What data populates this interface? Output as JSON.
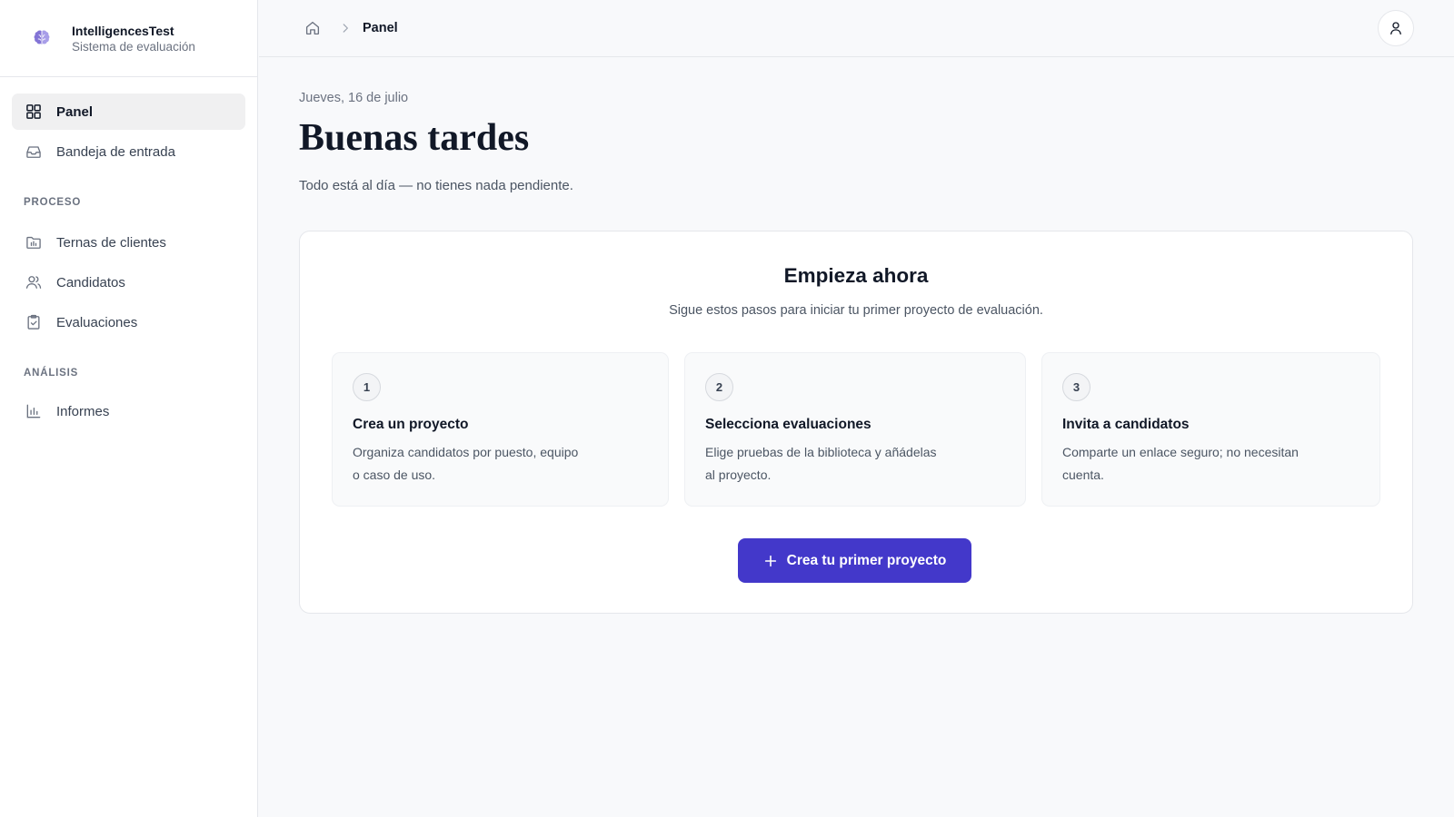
{
  "app": {
    "name": "IntelligencesTest",
    "subtitle": "Sistema de evaluación",
    "accent_color": "#4338ca"
  },
  "sidebar": {
    "top_items": [
      {
        "label": "Panel",
        "icon": "grid-icon",
        "active": true
      },
      {
        "label": "Bandeja de entrada",
        "icon": "inbox-icon",
        "active": false
      }
    ],
    "sections": [
      {
        "title": "PROCESO",
        "items": [
          {
            "label": "Ternas de clientes",
            "icon": "folder-calendar-icon"
          },
          {
            "label": "Candidatos",
            "icon": "users-icon"
          },
          {
            "label": "Evaluaciones",
            "icon": "clipboard-check-icon"
          }
        ]
      },
      {
        "title": "ANÁLISIS",
        "items": [
          {
            "label": "Informes",
            "icon": "bar-chart-icon"
          }
        ]
      }
    ]
  },
  "header": {
    "breadcrumb": {
      "home_icon": "home-icon",
      "current": "Panel"
    },
    "user_icon": "user-icon"
  },
  "main": {
    "date": "Jueves, 16 de julio",
    "greeting": "Buenas tardes",
    "status": "Todo está al día — no tienes nada pendiente.",
    "card": {
      "title": "Empieza ahora",
      "subtitle": "Sigue estos pasos para iniciar tu primer proyecto de evaluación.",
      "steps": [
        {
          "number": "1",
          "title": "Crea un proyecto",
          "line1": "Organiza candidatos por puesto, equipo",
          "line2": "o caso de uso."
        },
        {
          "number": "2",
          "title": "Selecciona evaluaciones",
          "line1": "Elige pruebas de la biblioteca y añádelas",
          "line2": "al proyecto."
        },
        {
          "number": "3",
          "title": "Invita a candidatos",
          "line1": "Comparte un enlace seguro; no necesitan",
          "line2": "cuenta."
        }
      ],
      "cta_label": "Crea tu primer proyecto",
      "cta_icon": "plus-icon"
    }
  }
}
